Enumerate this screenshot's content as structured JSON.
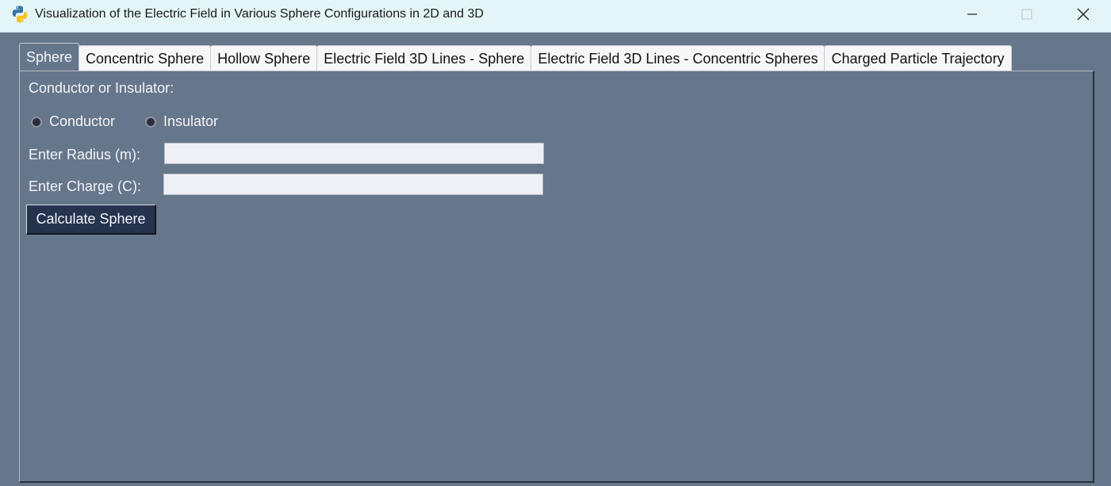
{
  "window": {
    "title": "Visualization of the Electric Field in Various Sphere Configurations in 2D and 3D",
    "app_icon": "python-icon"
  },
  "tabs": [
    {
      "label": "Sphere",
      "active": true
    },
    {
      "label": "Concentric Sphere",
      "active": false
    },
    {
      "label": "Hollow Sphere",
      "active": false
    },
    {
      "label": "Electric Field 3D Lines - Sphere",
      "active": false
    },
    {
      "label": "Electric Field 3D Lines - Concentric Spheres",
      "active": false
    },
    {
      "label": "Charged Particle Trajectory",
      "active": false
    }
  ],
  "form": {
    "type_label": "Conductor or Insulator:",
    "radio_conductor": "Conductor",
    "radio_insulator": "Insulator",
    "radius_label": "Enter Radius (m):",
    "radius_value": "",
    "charge_label": "Enter Charge (C):",
    "charge_value": "",
    "calculate_button": "Calculate Sphere"
  },
  "colors": {
    "background": "#66768b",
    "titlebar": "#e4f5f8",
    "button": "#26334f",
    "input": "#eef0f6"
  }
}
